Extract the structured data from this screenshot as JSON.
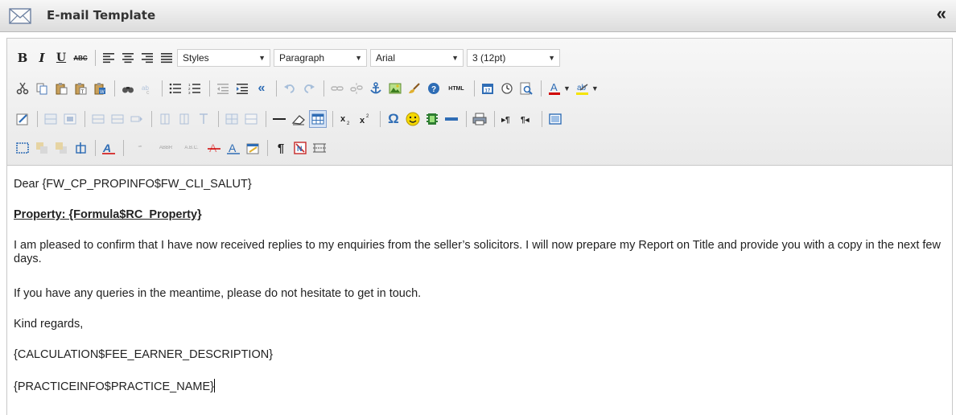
{
  "window": {
    "title": "E-mail Template",
    "icon": "envelope-icon",
    "collapse_icon": "double-chevron-left-icon"
  },
  "toolbar": {
    "styles": {
      "value": "Styles"
    },
    "format": {
      "value": "Paragraph"
    },
    "font": {
      "value": "Arial"
    },
    "size": {
      "value": "3 (12pt)"
    },
    "labels": {
      "bold": "B",
      "italic": "I",
      "underline": "U",
      "strike": "ABC",
      "html": "HTML",
      "special_char": "Ω",
      "text_color": "A",
      "bg_color": "ab",
      "pilcrow": "¶"
    }
  },
  "document": {
    "line1": "Dear {FW_CP_PROPINFO$FW_CLI_SALUT}",
    "line2": "Property: {Formula$RC_Property}",
    "line3": "I am pleased to confirm that I have now received replies to my enquiries from the seller’s solicitors.  I will now prepare my Report on Title and provide you with a copy in the next few days.",
    "line4": "If you have any queries in the meantime, please do not hesitate to get in touch.",
    "line5": "Kind regards,",
    "line6": "{CALCULATION$FEE_EARNER_DESCRIPTION}",
    "line7": "{PRACTICEINFO$PRACTICE_NAME}"
  },
  "colors": {
    "text_color_bar": "#d00000",
    "highlight_bar": "#f5e400",
    "accent_blue": "#2f6db5"
  }
}
